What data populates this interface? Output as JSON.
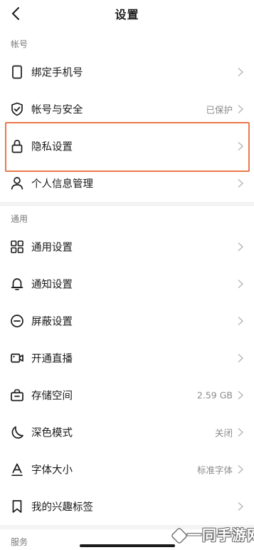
{
  "header": {
    "title": "设置"
  },
  "sections": {
    "account": "帐号",
    "general": "通用",
    "service": "服务"
  },
  "rows": {
    "bind_phone": {
      "label": "绑定手机号",
      "icon": "phone-icon"
    },
    "account_security": {
      "label": "帐号与安全",
      "value": "已保护",
      "icon": "shield-check-icon"
    },
    "privacy": {
      "label": "隐私设置",
      "icon": "lock-icon"
    },
    "personal_info": {
      "label": "个人信息管理",
      "icon": "person-icon"
    },
    "general_settings": {
      "label": "通用设置",
      "icon": "grid-icon"
    },
    "notifications": {
      "label": "通知设置",
      "icon": "bell-icon"
    },
    "block": {
      "label": "屏蔽设置",
      "icon": "block-icon"
    },
    "live": {
      "label": "开通直播",
      "icon": "video-icon"
    },
    "storage": {
      "label": "存储空间",
      "value": "2.59 GB",
      "icon": "storage-icon"
    },
    "dark_mode": {
      "label": "深色模式",
      "value": "关闭",
      "icon": "moon-icon"
    },
    "font_size": {
      "label": "字体大小",
      "value": "标准字体",
      "icon": "font-icon"
    },
    "interest_tags": {
      "label": "我的兴趣标签",
      "icon": "bookmark-icon"
    }
  },
  "watermark": {
    "text": "一同手游网"
  },
  "colors": {
    "highlight": "#e8794a",
    "divider": "#f4f4f4",
    "secondary_text": "#8a8a8a"
  }
}
